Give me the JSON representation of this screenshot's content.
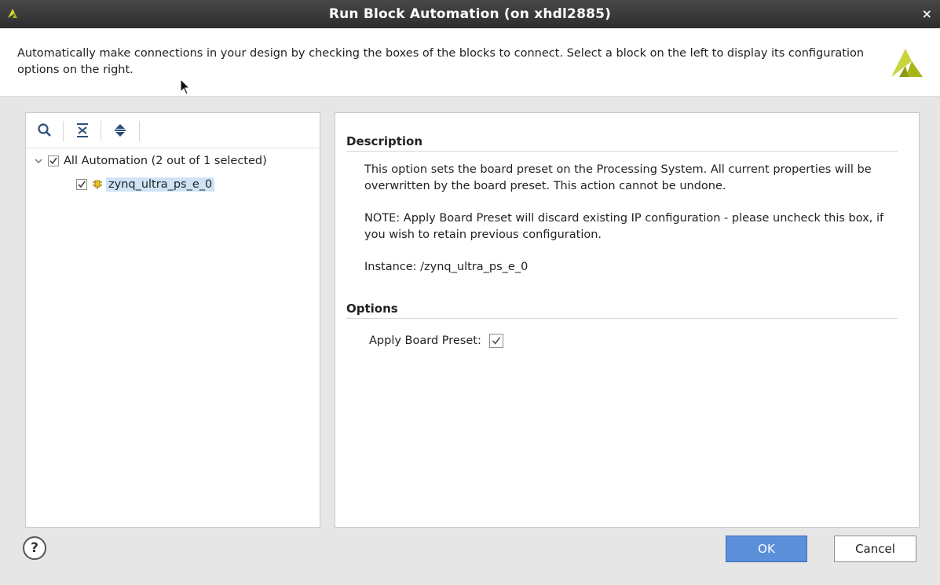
{
  "window": {
    "title": "Run Block Automation (on xhdl2885)",
    "close_glyph": "×"
  },
  "header": {
    "description": "Automatically make connections in your design by checking the boxes of the blocks to connect. Select a block on the left to display its configuration options on the right."
  },
  "tree": {
    "toolbar": [
      "search-icon",
      "collapse-all-icon",
      "expand-all-icon"
    ],
    "root": {
      "label": "All Automation (2 out of 1 selected)",
      "checked": true,
      "expanded": true
    },
    "child": {
      "label": "zynq_ultra_ps_e_0",
      "checked": true,
      "selected": true
    }
  },
  "details": {
    "description_heading": "Description",
    "description_text": "This option sets the board preset on the Processing System. All current properties will be overwritten by the board preset. This action cannot be undone.",
    "note_text": "NOTE: Apply Board Preset will discard existing IP configuration - please uncheck this box, if you wish to retain previous configuration.",
    "instance_text": "Instance: /zynq_ultra_ps_e_0",
    "options_heading": "Options",
    "option_label": "Apply Board Preset:",
    "option_checked": true
  },
  "footer": {
    "help_label": "?",
    "ok_label": "OK",
    "cancel_label": "Cancel"
  },
  "colors": {
    "titlebar": "#3a3a3a",
    "accent": "#5b8fd9",
    "selection": "#cfe3f7",
    "logo": "#a8b51a"
  }
}
